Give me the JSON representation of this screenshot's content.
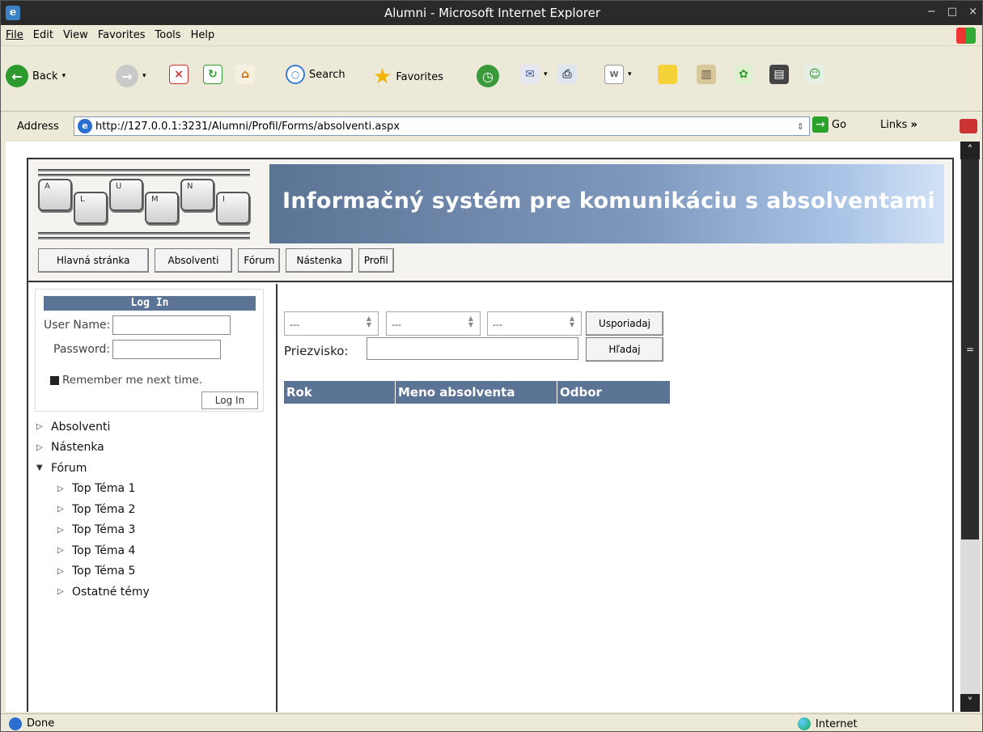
{
  "window": {
    "title": "Alumni - Microsoft Internet Explorer",
    "controls": [
      "−",
      "□",
      "×"
    ]
  },
  "menubar": {
    "items": [
      {
        "label": "File"
      },
      {
        "label": "Edit"
      },
      {
        "label": "View"
      },
      {
        "label": "Favorites"
      },
      {
        "label": "Tools"
      },
      {
        "label": "Help"
      }
    ]
  },
  "toolbar": {
    "back": "Back",
    "search": "Search",
    "favorites": "Favorites"
  },
  "address": {
    "label": "Address",
    "url": "http://127.0.0.1:3231/Alumni/Profil/Forms/absolventi.aspx",
    "go": "Go",
    "links": "Links"
  },
  "site": {
    "logo_keys": [
      "A",
      "L",
      "U",
      "M",
      "N",
      "I"
    ],
    "banner": "Informačný systém pre komunikáciu s absolventami",
    "nav": [
      "Hlavná stránka",
      "Absolventi",
      "Fórum",
      "Nástenka",
      "Profil"
    ]
  },
  "login": {
    "title": "Log In",
    "username_label": "User Name:",
    "password_label": "Password:",
    "remember": "Remember me next time.",
    "button": "Log In"
  },
  "tree": {
    "absolventi": "Absolventi",
    "nastenka": "Nástenka",
    "forum": "Fórum",
    "topics": [
      "Top Téma 1",
      "Top Téma 2",
      "Top Téma 3",
      "Top Téma 4",
      "Top Téma 5",
      "Ostatné témy"
    ]
  },
  "main": {
    "select1": "---",
    "select2": "---",
    "select3": "---",
    "sort_button": "Usporiadaj",
    "search_button": "Hľadaj",
    "surname_label": "Priezvisko:",
    "surname_value": "",
    "columns": [
      "Rok",
      "Meno absolventa",
      "Odbor"
    ]
  },
  "status": {
    "text": "Done",
    "zone": "Internet"
  }
}
